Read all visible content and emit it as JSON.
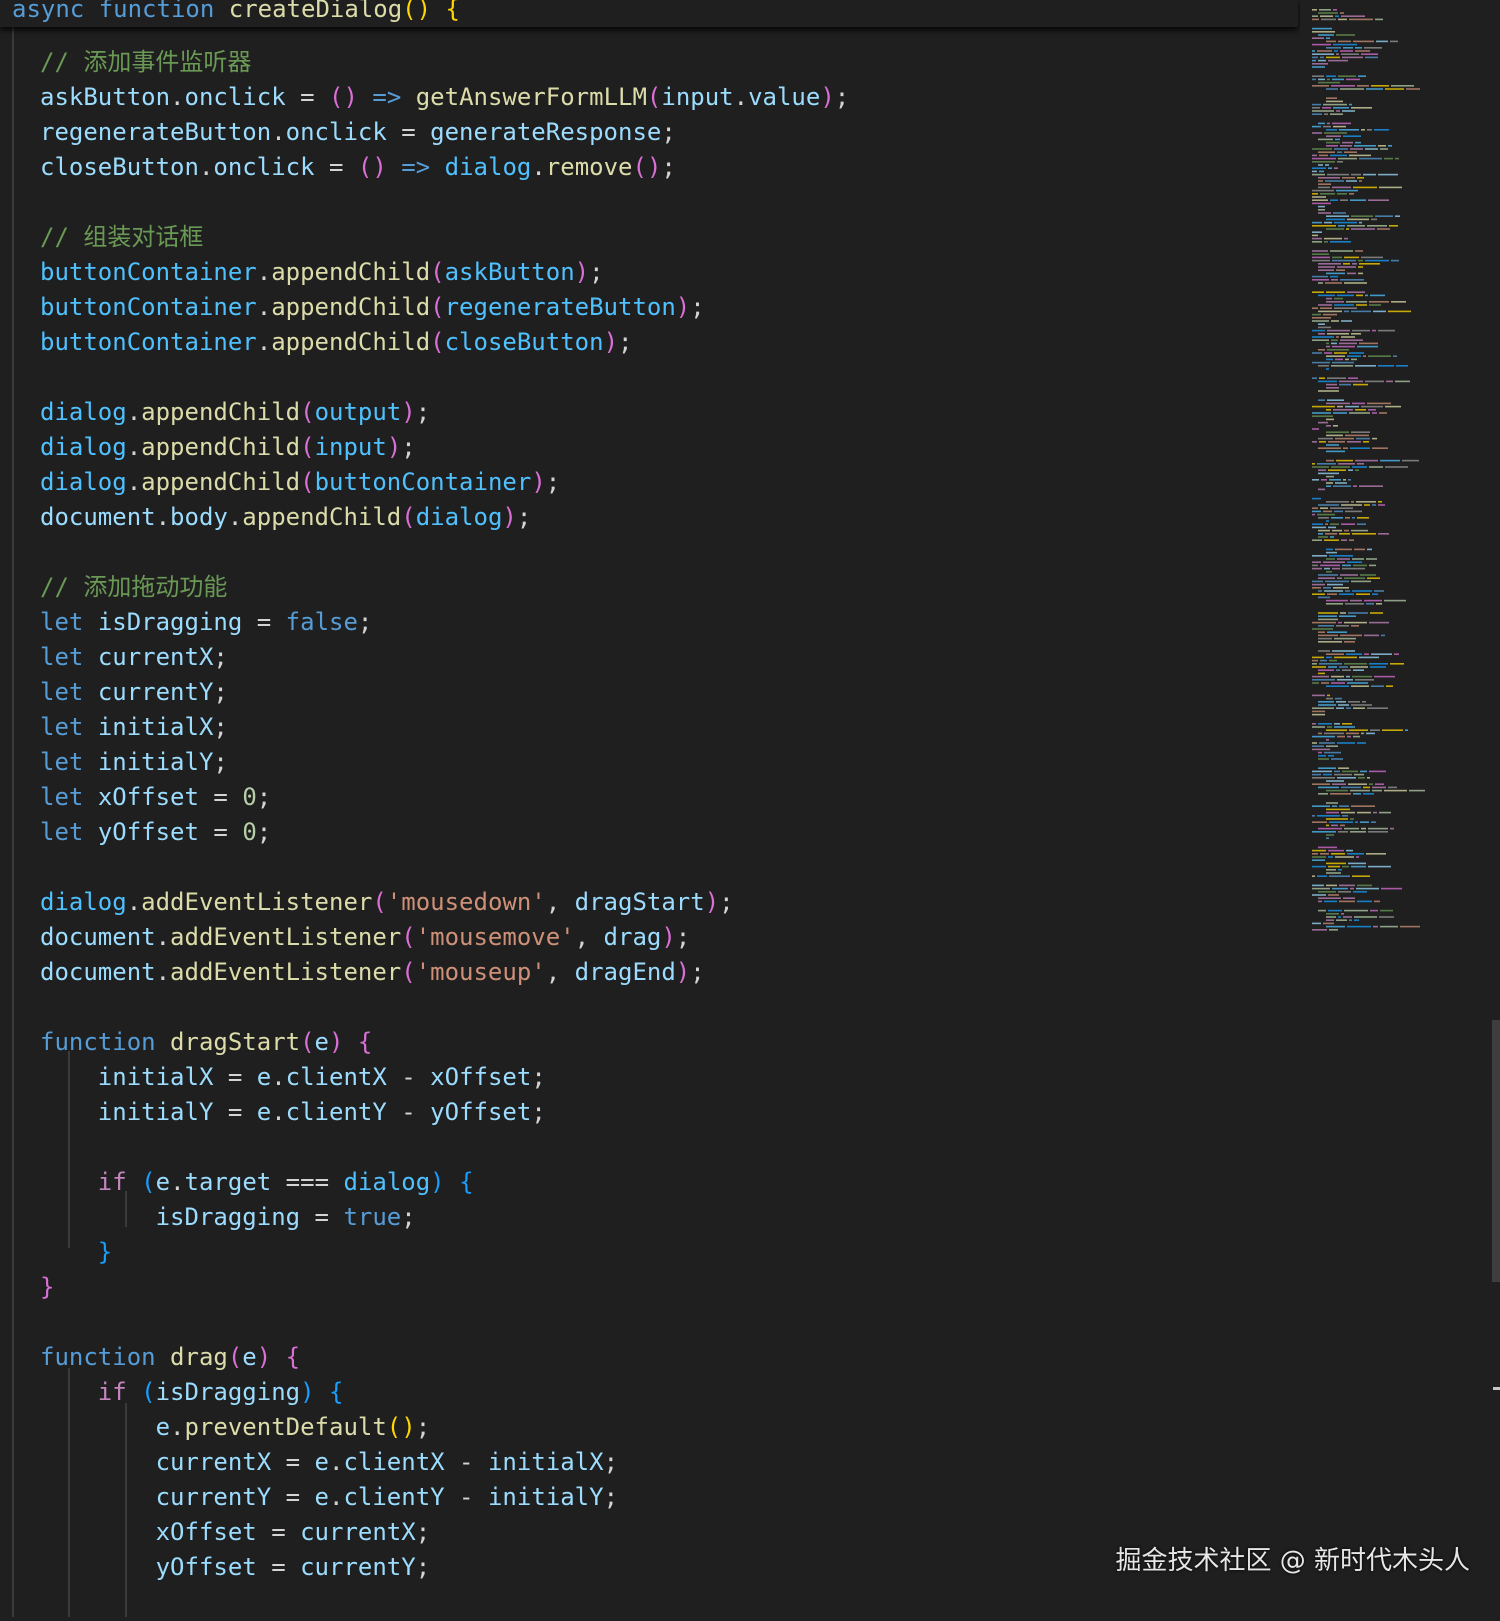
{
  "editor": {
    "sticky_header": [
      [
        "kw",
        "async"
      ],
      [
        "op",
        " "
      ],
      [
        "kw",
        "function"
      ],
      [
        "op",
        " "
      ],
      [
        "fn",
        "createDialog"
      ],
      [
        "p1",
        "()"
      ],
      [
        "op",
        " "
      ],
      [
        "p1",
        "{"
      ]
    ],
    "lines": [
      [
        [
          "cm",
          "// 添加事件监听器"
        ]
      ],
      [
        [
          "var",
          "askButton"
        ],
        [
          "op",
          "."
        ],
        [
          "var",
          "onclick"
        ],
        [
          "op",
          " = "
        ],
        [
          "p2",
          "()"
        ],
        [
          "op",
          " "
        ],
        [
          "kw",
          "=>"
        ],
        [
          "op",
          " "
        ],
        [
          "fn",
          "getAnswerFormLLM"
        ],
        [
          "p2",
          "("
        ],
        [
          "var",
          "input"
        ],
        [
          "op",
          "."
        ],
        [
          "var",
          "value"
        ],
        [
          "p2",
          ")"
        ],
        [
          "op",
          ";"
        ]
      ],
      [
        [
          "var",
          "regenerateButton"
        ],
        [
          "op",
          "."
        ],
        [
          "var",
          "onclick"
        ],
        [
          "op",
          " = "
        ],
        [
          "var",
          "generateResponse"
        ],
        [
          "op",
          ";"
        ]
      ],
      [
        [
          "var",
          "closeButton"
        ],
        [
          "op",
          "."
        ],
        [
          "var",
          "onclick"
        ],
        [
          "op",
          " = "
        ],
        [
          "p2",
          "()"
        ],
        [
          "op",
          " "
        ],
        [
          "kw",
          "=>"
        ],
        [
          "op",
          " "
        ],
        [
          "var2",
          "dialog"
        ],
        [
          "op",
          "."
        ],
        [
          "fn",
          "remove"
        ],
        [
          "p2",
          "()"
        ],
        [
          "op",
          ";"
        ]
      ],
      [],
      [
        [
          "cm",
          "// 组装对话框"
        ]
      ],
      [
        [
          "var2",
          "buttonContainer"
        ],
        [
          "op",
          "."
        ],
        [
          "fn",
          "appendChild"
        ],
        [
          "p2",
          "("
        ],
        [
          "var2",
          "askButton"
        ],
        [
          "p2",
          ")"
        ],
        [
          "op",
          ";"
        ]
      ],
      [
        [
          "var2",
          "buttonContainer"
        ],
        [
          "op",
          "."
        ],
        [
          "fn",
          "appendChild"
        ],
        [
          "p2",
          "("
        ],
        [
          "var2",
          "regenerateButton"
        ],
        [
          "p2",
          ")"
        ],
        [
          "op",
          ";"
        ]
      ],
      [
        [
          "var2",
          "buttonContainer"
        ],
        [
          "op",
          "."
        ],
        [
          "fn",
          "appendChild"
        ],
        [
          "p2",
          "("
        ],
        [
          "var2",
          "closeButton"
        ],
        [
          "p2",
          ")"
        ],
        [
          "op",
          ";"
        ]
      ],
      [],
      [
        [
          "var2",
          "dialog"
        ],
        [
          "op",
          "."
        ],
        [
          "fn",
          "appendChild"
        ],
        [
          "p2",
          "("
        ],
        [
          "var2",
          "output"
        ],
        [
          "p2",
          ")"
        ],
        [
          "op",
          ";"
        ]
      ],
      [
        [
          "var2",
          "dialog"
        ],
        [
          "op",
          "."
        ],
        [
          "fn",
          "appendChild"
        ],
        [
          "p2",
          "("
        ],
        [
          "var2",
          "input"
        ],
        [
          "p2",
          ")"
        ],
        [
          "op",
          ";"
        ]
      ],
      [
        [
          "var2",
          "dialog"
        ],
        [
          "op",
          "."
        ],
        [
          "fn",
          "appendChild"
        ],
        [
          "p2",
          "("
        ],
        [
          "var2",
          "buttonContainer"
        ],
        [
          "p2",
          ")"
        ],
        [
          "op",
          ";"
        ]
      ],
      [
        [
          "var",
          "document"
        ],
        [
          "op",
          "."
        ],
        [
          "var",
          "body"
        ],
        [
          "op",
          "."
        ],
        [
          "fn",
          "appendChild"
        ],
        [
          "p2",
          "("
        ],
        [
          "var2",
          "dialog"
        ],
        [
          "p2",
          ")"
        ],
        [
          "op",
          ";"
        ]
      ],
      [],
      [
        [
          "cm",
          "// 添加拖动功能"
        ]
      ],
      [
        [
          "kw",
          "let"
        ],
        [
          "op",
          " "
        ],
        [
          "var",
          "isDragging"
        ],
        [
          "op",
          " = "
        ],
        [
          "kw",
          "false"
        ],
        [
          "op",
          ";"
        ]
      ],
      [
        [
          "kw",
          "let"
        ],
        [
          "op",
          " "
        ],
        [
          "var",
          "currentX"
        ],
        [
          "op",
          ";"
        ]
      ],
      [
        [
          "kw",
          "let"
        ],
        [
          "op",
          " "
        ],
        [
          "var",
          "currentY"
        ],
        [
          "op",
          ";"
        ]
      ],
      [
        [
          "kw",
          "let"
        ],
        [
          "op",
          " "
        ],
        [
          "var",
          "initialX"
        ],
        [
          "op",
          ";"
        ]
      ],
      [
        [
          "kw",
          "let"
        ],
        [
          "op",
          " "
        ],
        [
          "var",
          "initialY"
        ],
        [
          "op",
          ";"
        ]
      ],
      [
        [
          "kw",
          "let"
        ],
        [
          "op",
          " "
        ],
        [
          "var",
          "xOffset"
        ],
        [
          "op",
          " = "
        ],
        [
          "num",
          "0"
        ],
        [
          "op",
          ";"
        ]
      ],
      [
        [
          "kw",
          "let"
        ],
        [
          "op",
          " "
        ],
        [
          "var",
          "yOffset"
        ],
        [
          "op",
          " = "
        ],
        [
          "num",
          "0"
        ],
        [
          "op",
          ";"
        ]
      ],
      [],
      [
        [
          "var2",
          "dialog"
        ],
        [
          "op",
          "."
        ],
        [
          "fn",
          "addEventListener"
        ],
        [
          "p2",
          "("
        ],
        [
          "str",
          "'mousedown'"
        ],
        [
          "op",
          ", "
        ],
        [
          "var",
          "dragStart"
        ],
        [
          "p2",
          ")"
        ],
        [
          "op",
          ";"
        ]
      ],
      [
        [
          "var",
          "document"
        ],
        [
          "op",
          "."
        ],
        [
          "fn",
          "addEventListener"
        ],
        [
          "p2",
          "("
        ],
        [
          "str",
          "'mousemove'"
        ],
        [
          "op",
          ", "
        ],
        [
          "var",
          "drag"
        ],
        [
          "p2",
          ")"
        ],
        [
          "op",
          ";"
        ]
      ],
      [
        [
          "var",
          "document"
        ],
        [
          "op",
          "."
        ],
        [
          "fn",
          "addEventListener"
        ],
        [
          "p2",
          "("
        ],
        [
          "str",
          "'mouseup'"
        ],
        [
          "op",
          ", "
        ],
        [
          "var",
          "dragEnd"
        ],
        [
          "p2",
          ")"
        ],
        [
          "op",
          ";"
        ]
      ],
      [],
      [
        [
          "kw",
          "function"
        ],
        [
          "op",
          " "
        ],
        [
          "fn",
          "dragStart"
        ],
        [
          "p2",
          "("
        ],
        [
          "var",
          "e"
        ],
        [
          "p2",
          ")"
        ],
        [
          "op",
          " "
        ],
        [
          "p2",
          "{"
        ]
      ],
      [
        [
          "op",
          "    "
        ],
        [
          "var",
          "initialX"
        ],
        [
          "op",
          " = "
        ],
        [
          "var",
          "e"
        ],
        [
          "op",
          "."
        ],
        [
          "var",
          "clientX"
        ],
        [
          "op",
          " - "
        ],
        [
          "var",
          "xOffset"
        ],
        [
          "op",
          ";"
        ]
      ],
      [
        [
          "op",
          "    "
        ],
        [
          "var",
          "initialY"
        ],
        [
          "op",
          " = "
        ],
        [
          "var",
          "e"
        ],
        [
          "op",
          "."
        ],
        [
          "var",
          "clientY"
        ],
        [
          "op",
          " - "
        ],
        [
          "var",
          "yOffset"
        ],
        [
          "op",
          ";"
        ]
      ],
      [],
      [
        [
          "op",
          "    "
        ],
        [
          "ctl",
          "if"
        ],
        [
          "op",
          " "
        ],
        [
          "p3",
          "("
        ],
        [
          "var",
          "e"
        ],
        [
          "op",
          "."
        ],
        [
          "var",
          "target"
        ],
        [
          "op",
          " === "
        ],
        [
          "var2",
          "dialog"
        ],
        [
          "p3",
          ")"
        ],
        [
          "op",
          " "
        ],
        [
          "p3",
          "{"
        ]
      ],
      [
        [
          "op",
          "        "
        ],
        [
          "var",
          "isDragging"
        ],
        [
          "op",
          " = "
        ],
        [
          "kw",
          "true"
        ],
        [
          "op",
          ";"
        ]
      ],
      [
        [
          "op",
          "    "
        ],
        [
          "p3",
          "}"
        ]
      ],
      [
        [
          "p2",
          "}"
        ]
      ],
      [],
      [
        [
          "kw",
          "function"
        ],
        [
          "op",
          " "
        ],
        [
          "fn",
          "drag"
        ],
        [
          "p2",
          "("
        ],
        [
          "var",
          "e"
        ],
        [
          "p2",
          ")"
        ],
        [
          "op",
          " "
        ],
        [
          "p2",
          "{"
        ]
      ],
      [
        [
          "op",
          "    "
        ],
        [
          "ctl",
          "if"
        ],
        [
          "op",
          " "
        ],
        [
          "p3",
          "("
        ],
        [
          "var",
          "isDragging"
        ],
        [
          "p3",
          ")"
        ],
        [
          "op",
          " "
        ],
        [
          "p3",
          "{"
        ]
      ],
      [
        [
          "op",
          "        "
        ],
        [
          "var",
          "e"
        ],
        [
          "op",
          "."
        ],
        [
          "fn",
          "preventDefault"
        ],
        [
          "p1",
          "()"
        ],
        [
          "op",
          ";"
        ]
      ],
      [
        [
          "op",
          "        "
        ],
        [
          "var",
          "currentX"
        ],
        [
          "op",
          " = "
        ],
        [
          "var",
          "e"
        ],
        [
          "op",
          "."
        ],
        [
          "var",
          "clientX"
        ],
        [
          "op",
          " - "
        ],
        [
          "var",
          "initialX"
        ],
        [
          "op",
          ";"
        ]
      ],
      [
        [
          "op",
          "        "
        ],
        [
          "var",
          "currentY"
        ],
        [
          "op",
          " = "
        ],
        [
          "var",
          "e"
        ],
        [
          "op",
          "."
        ],
        [
          "var",
          "clientY"
        ],
        [
          "op",
          " - "
        ],
        [
          "var",
          "initialY"
        ],
        [
          "op",
          ";"
        ]
      ],
      [
        [
          "op",
          "        "
        ],
        [
          "var",
          "xOffset"
        ],
        [
          "op",
          " = "
        ],
        [
          "var",
          "currentX"
        ],
        [
          "op",
          ";"
        ]
      ],
      [
        [
          "op",
          "        "
        ],
        [
          "var",
          "yOffset"
        ],
        [
          "op",
          " = "
        ],
        [
          "var",
          "currentY"
        ],
        [
          "op",
          ";"
        ]
      ]
    ]
  },
  "watermark": "掘金技术社区 @ 新时代木头人"
}
